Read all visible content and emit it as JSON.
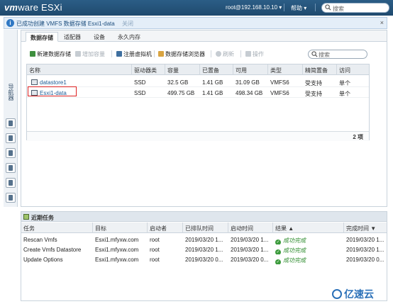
{
  "header": {
    "brand_vm": "vm",
    "brand_ware": "ware",
    "brand_esxi": " ESXi",
    "user": "root@192.168.10.10 ▾",
    "help": "帮助 ▾",
    "search_placeholder": "搜索"
  },
  "notification": {
    "message": "已成功创建 VMFS 数据存储 Esxi1-data",
    "close_text": "关闭",
    "dismiss": "×"
  },
  "leftnav": {
    "label": "导航器"
  },
  "tabs": [
    "数据存储",
    "适配器",
    "设备",
    "永久内存"
  ],
  "toolbar": {
    "new_datastore": "新建数据存储",
    "increase_capacity": "增加容量",
    "register_vm": "注册虚拟机",
    "datastore_browser": "数据存储浏览器",
    "refresh": "刷新",
    "actions": "操作",
    "search_placeholder": "搜索"
  },
  "datastore_table": {
    "columns": [
      "名称",
      "驱动器类",
      "容量",
      "已置备",
      "可用",
      "类型",
      "精简置备",
      "访问"
    ],
    "rows": [
      [
        "datastore1",
        "SSD",
        "32.5 GB",
        "1.41 GB",
        "31.09 GB",
        "VMFS6",
        "受支持",
        "单个"
      ],
      [
        "Esxi1-data",
        "SSD",
        "499.75 GB",
        "1.41 GB",
        "498.34 GB",
        "VMFS6",
        "受支持",
        "单个"
      ]
    ],
    "count": "2 项"
  },
  "recent_tasks": {
    "title": "近期任务",
    "columns": [
      "任务",
      "目标",
      "启动者",
      "已排队时间",
      "启动时间",
      "结果 ▲",
      "完成时间 ▼"
    ],
    "rows": [
      [
        "Rescan Vmfs",
        "Esxi1.mfyxw.com",
        "root",
        "2019/03/20 1...",
        "2019/03/20 1...",
        "成功完成",
        "2019/03/20 1..."
      ],
      [
        "Create Vmfs Datastore",
        "Esxi1.mfyxw.com",
        "root",
        "2019/03/20 1...",
        "2019/03/20 1...",
        "成功完成",
        "2019/03/20 1..."
      ],
      [
        "Update Options",
        "Esxi1.mfyxw.com",
        "root",
        "2019/03/20 0...",
        "2019/03/20 0...",
        "成功完成",
        "2019/03/20 0..."
      ]
    ]
  },
  "watermark": "亿速云"
}
